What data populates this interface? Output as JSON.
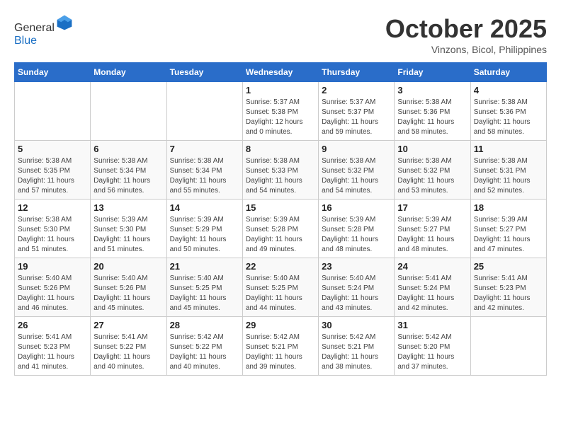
{
  "logo": {
    "general": "General",
    "blue": "Blue"
  },
  "title": "October 2025",
  "subtitle": "Vinzons, Bicol, Philippines",
  "days_of_week": [
    "Sunday",
    "Monday",
    "Tuesday",
    "Wednesday",
    "Thursday",
    "Friday",
    "Saturday"
  ],
  "weeks": [
    [
      {
        "day": "",
        "info": ""
      },
      {
        "day": "",
        "info": ""
      },
      {
        "day": "",
        "info": ""
      },
      {
        "day": "1",
        "info": "Sunrise: 5:37 AM\nSunset: 5:38 PM\nDaylight: 12 hours and 0 minutes."
      },
      {
        "day": "2",
        "info": "Sunrise: 5:37 AM\nSunset: 5:37 PM\nDaylight: 11 hours and 59 minutes."
      },
      {
        "day": "3",
        "info": "Sunrise: 5:38 AM\nSunset: 5:36 PM\nDaylight: 11 hours and 58 minutes."
      },
      {
        "day": "4",
        "info": "Sunrise: 5:38 AM\nSunset: 5:36 PM\nDaylight: 11 hours and 58 minutes."
      }
    ],
    [
      {
        "day": "5",
        "info": "Sunrise: 5:38 AM\nSunset: 5:35 PM\nDaylight: 11 hours and 57 minutes."
      },
      {
        "day": "6",
        "info": "Sunrise: 5:38 AM\nSunset: 5:34 PM\nDaylight: 11 hours and 56 minutes."
      },
      {
        "day": "7",
        "info": "Sunrise: 5:38 AM\nSunset: 5:34 PM\nDaylight: 11 hours and 55 minutes."
      },
      {
        "day": "8",
        "info": "Sunrise: 5:38 AM\nSunset: 5:33 PM\nDaylight: 11 hours and 54 minutes."
      },
      {
        "day": "9",
        "info": "Sunrise: 5:38 AM\nSunset: 5:32 PM\nDaylight: 11 hours and 54 minutes."
      },
      {
        "day": "10",
        "info": "Sunrise: 5:38 AM\nSunset: 5:32 PM\nDaylight: 11 hours and 53 minutes."
      },
      {
        "day": "11",
        "info": "Sunrise: 5:38 AM\nSunset: 5:31 PM\nDaylight: 11 hours and 52 minutes."
      }
    ],
    [
      {
        "day": "12",
        "info": "Sunrise: 5:38 AM\nSunset: 5:30 PM\nDaylight: 11 hours and 51 minutes."
      },
      {
        "day": "13",
        "info": "Sunrise: 5:39 AM\nSunset: 5:30 PM\nDaylight: 11 hours and 51 minutes."
      },
      {
        "day": "14",
        "info": "Sunrise: 5:39 AM\nSunset: 5:29 PM\nDaylight: 11 hours and 50 minutes."
      },
      {
        "day": "15",
        "info": "Sunrise: 5:39 AM\nSunset: 5:28 PM\nDaylight: 11 hours and 49 minutes."
      },
      {
        "day": "16",
        "info": "Sunrise: 5:39 AM\nSunset: 5:28 PM\nDaylight: 11 hours and 48 minutes."
      },
      {
        "day": "17",
        "info": "Sunrise: 5:39 AM\nSunset: 5:27 PM\nDaylight: 11 hours and 48 minutes."
      },
      {
        "day": "18",
        "info": "Sunrise: 5:39 AM\nSunset: 5:27 PM\nDaylight: 11 hours and 47 minutes."
      }
    ],
    [
      {
        "day": "19",
        "info": "Sunrise: 5:40 AM\nSunset: 5:26 PM\nDaylight: 11 hours and 46 minutes."
      },
      {
        "day": "20",
        "info": "Sunrise: 5:40 AM\nSunset: 5:26 PM\nDaylight: 11 hours and 45 minutes."
      },
      {
        "day": "21",
        "info": "Sunrise: 5:40 AM\nSunset: 5:25 PM\nDaylight: 11 hours and 45 minutes."
      },
      {
        "day": "22",
        "info": "Sunrise: 5:40 AM\nSunset: 5:25 PM\nDaylight: 11 hours and 44 minutes."
      },
      {
        "day": "23",
        "info": "Sunrise: 5:40 AM\nSunset: 5:24 PM\nDaylight: 11 hours and 43 minutes."
      },
      {
        "day": "24",
        "info": "Sunrise: 5:41 AM\nSunset: 5:24 PM\nDaylight: 11 hours and 42 minutes."
      },
      {
        "day": "25",
        "info": "Sunrise: 5:41 AM\nSunset: 5:23 PM\nDaylight: 11 hours and 42 minutes."
      }
    ],
    [
      {
        "day": "26",
        "info": "Sunrise: 5:41 AM\nSunset: 5:23 PM\nDaylight: 11 hours and 41 minutes."
      },
      {
        "day": "27",
        "info": "Sunrise: 5:41 AM\nSunset: 5:22 PM\nDaylight: 11 hours and 40 minutes."
      },
      {
        "day": "28",
        "info": "Sunrise: 5:42 AM\nSunset: 5:22 PM\nDaylight: 11 hours and 40 minutes."
      },
      {
        "day": "29",
        "info": "Sunrise: 5:42 AM\nSunset: 5:21 PM\nDaylight: 11 hours and 39 minutes."
      },
      {
        "day": "30",
        "info": "Sunrise: 5:42 AM\nSunset: 5:21 PM\nDaylight: 11 hours and 38 minutes."
      },
      {
        "day": "31",
        "info": "Sunrise: 5:42 AM\nSunset: 5:20 PM\nDaylight: 11 hours and 37 minutes."
      },
      {
        "day": "",
        "info": ""
      }
    ]
  ]
}
